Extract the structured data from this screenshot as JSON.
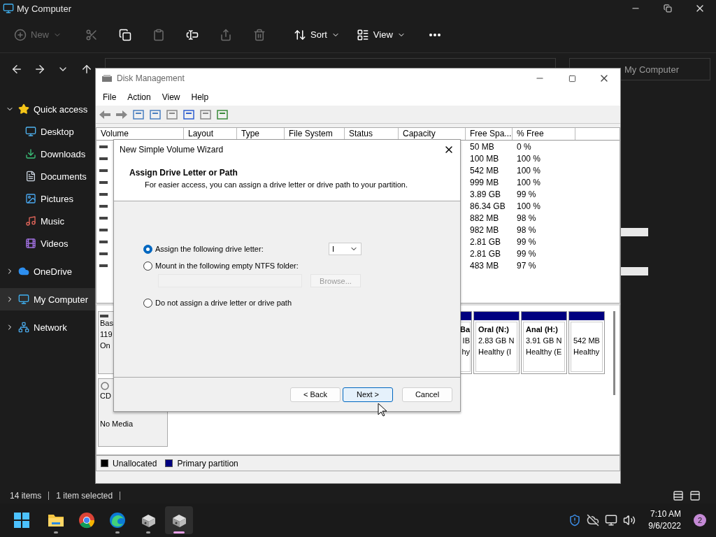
{
  "explorer": {
    "title": "My Computer",
    "toolbar": [
      {
        "kind": "new",
        "label": "New",
        "disabled": true
      },
      {
        "kind": "cut",
        "disabled": true
      },
      {
        "kind": "copy",
        "disabled": false
      },
      {
        "kind": "paste",
        "disabled": true
      },
      {
        "kind": "rename",
        "disabled": false
      },
      {
        "kind": "share",
        "disabled": true
      },
      {
        "kind": "delete",
        "disabled": true
      },
      {
        "kind": "sort",
        "label": "Sort",
        "disabled": false
      },
      {
        "kind": "view",
        "label": "View",
        "disabled": false
      },
      {
        "kind": "more",
        "disabled": false
      }
    ],
    "search": {
      "placeholder": "My Computer"
    },
    "sidebar": [
      {
        "kind": "star",
        "label": "Quick access",
        "expanded": true,
        "selected": false,
        "children": [
          {
            "kind": "desktop",
            "label": "Desktop",
            "selected": false
          },
          {
            "kind": "downloads",
            "label": "Downloads",
            "selected": false
          },
          {
            "kind": "documents",
            "label": "Documents",
            "selected": false
          },
          {
            "kind": "pictures",
            "label": "Pictures",
            "selected": false
          },
          {
            "kind": "music",
            "label": "Music",
            "selected": false
          },
          {
            "kind": "videos",
            "label": "Videos",
            "selected": false
          }
        ]
      },
      {
        "kind": "cloud",
        "label": "OneDrive",
        "expanded": false,
        "selected": false
      },
      {
        "kind": "computer",
        "label": "My Computer",
        "expanded": false,
        "selected": true
      },
      {
        "kind": "network",
        "label": "Network",
        "expanded": false,
        "selected": false
      }
    ],
    "status_bar": [
      "14 items",
      "1 item selected"
    ]
  },
  "disk_management": {
    "title": "Disk Management",
    "menu": [
      "File",
      "Action",
      "View",
      "Help"
    ],
    "table": {
      "columns": [
        "Volume",
        "Layout",
        "Type",
        "File System",
        "Status",
        "Capacity",
        "Free Spa...",
        "% Free"
      ],
      "rows": [
        {
          "free": "50 MB",
          "pct_free": "0 %"
        },
        {
          "free": "100 MB",
          "pct_free": "100 %"
        },
        {
          "free": "542 MB",
          "pct_free": "100 %"
        },
        {
          "free": "999 MB",
          "pct_free": "100 %"
        },
        {
          "free": "3.89 GB",
          "pct_free": "99 %"
        },
        {
          "free": "86.34 GB",
          "pct_free": "100 %"
        },
        {
          "free": "882 MB",
          "pct_free": "98 %"
        },
        {
          "free": "982 MB",
          "pct_free": "98 %"
        },
        {
          "free": "2.81 GB",
          "pct_free": "99 %"
        },
        {
          "free": "2.81 GB",
          "pct_free": "99 %"
        },
        {
          "free": "483 MB",
          "pct_free": "97 %"
        }
      ]
    },
    "disks": [
      {
        "kind": "hdd",
        "lines": [
          "Bas",
          "119",
          "On"
        ],
        "partitions": [
          {
            "kind": "primary",
            "name": "Ba",
            "size": "IB",
            "status": "hy"
          },
          {
            "kind": "primary",
            "name": "Oral  (N:)",
            "size": "2.83 GB N",
            "status": "Healthy (I"
          },
          {
            "kind": "primary",
            "name": "Anal  (H:)",
            "size": "3.91 GB N",
            "status": "Healthy (E"
          },
          {
            "kind": "primary",
            "size": "542 MB",
            "status": "Healthy"
          }
        ]
      },
      {
        "kind": "cd",
        "lines": [
          "CD",
          "No Media"
        ]
      }
    ],
    "legend": [
      {
        "label": "Unallocated",
        "color": "#000000"
      },
      {
        "label": "Primary partition",
        "color": "#000080"
      }
    ]
  },
  "wizard": {
    "title": "New Simple Volume Wizard",
    "heading": "Assign Drive Letter or Path",
    "subheading": "For easier access, you can assign a drive letter or drive path to your partition.",
    "options": [
      {
        "kind": "letter",
        "label": "Assign the following drive letter:",
        "selected": true
      },
      {
        "kind": "folder",
        "label": "Mount in the following empty NTFS folder:",
        "selected": false
      },
      {
        "kind": "none",
        "label": "Do not assign a drive letter or drive path",
        "selected": false
      }
    ],
    "drive_letter": "I",
    "browse": {
      "label": "Browse...",
      "disabled": true
    },
    "buttons": [
      {
        "label": "< Back",
        "focused": false
      },
      {
        "label": "Next >",
        "focused": true
      },
      {
        "label": "Cancel",
        "focused": false
      }
    ]
  },
  "taskbar": {
    "apps": [
      {
        "kind": "folder",
        "running": true,
        "active": false
      },
      {
        "kind": "chrome",
        "running": false,
        "active": false
      },
      {
        "kind": "edge",
        "running": true,
        "active": false
      },
      {
        "kind": "disk",
        "running": true,
        "active": false
      },
      {
        "kind": "disk",
        "running": true,
        "active": true
      }
    ],
    "time": "7:10 AM",
    "date": "9/6/2022",
    "notifications": "2"
  }
}
